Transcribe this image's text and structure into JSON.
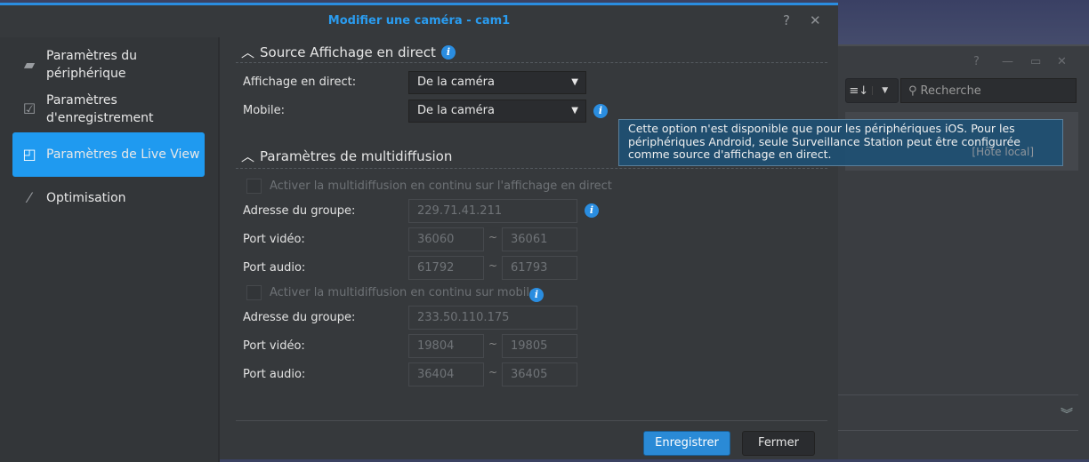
{
  "dialog": {
    "title": "Modifier une caméra - cam1",
    "help": "?",
    "close": "✕"
  },
  "sidebar": {
    "items": [
      {
        "label": "Paramètres du périphérique",
        "icon": "camera-icon"
      },
      {
        "label": "Paramètres d'enregistrement",
        "icon": "calendar-check-icon"
      },
      {
        "label": "Paramètres de Live View",
        "icon": "live-view-icon",
        "active": true
      },
      {
        "label": "Optimisation",
        "icon": "magic-wand-icon"
      }
    ]
  },
  "source": {
    "title": "Source Affichage en direct",
    "live_label": "Affichage en direct:",
    "live_value": "De la caméra",
    "mobile_label": "Mobile:",
    "mobile_value": "De la caméra"
  },
  "multicast": {
    "title": "Paramètres de multidiffusion",
    "live": {
      "checkbox": "Activer la multidiffusion en continu sur l'affichage en direct",
      "addr_label": "Adresse du groupe:",
      "addr": "229.71.41.211",
      "video_label": "Port vidéo:",
      "video_from": "36060",
      "video_to": "36061",
      "audio_label": "Port audio:",
      "audio_from": "61792",
      "audio_to": "61793"
    },
    "mobile": {
      "checkbox": "Activer la multidiffusion en continu sur mobile",
      "addr_label": "Adresse du groupe:",
      "addr": "233.50.110.175",
      "video_label": "Port vidéo:",
      "video_from": "19804",
      "video_to": "19805",
      "audio_label": "Port audio:",
      "audio_from": "36404",
      "audio_to": "36405"
    },
    "tilde": "~"
  },
  "tooltip": "Cette option n'est disponible que pour les périphériques iOS. Pour les périphériques Android, seule Surveillance Station peut être configurée comme source d'affichage en direct.",
  "footer": {
    "save": "Enregistrer",
    "close": "Fermer"
  },
  "background": {
    "search_placeholder": "Recherche",
    "row_text": "[Hôte local]"
  },
  "colors": {
    "accent": "#2a8de0",
    "active": "#1f9af0"
  }
}
